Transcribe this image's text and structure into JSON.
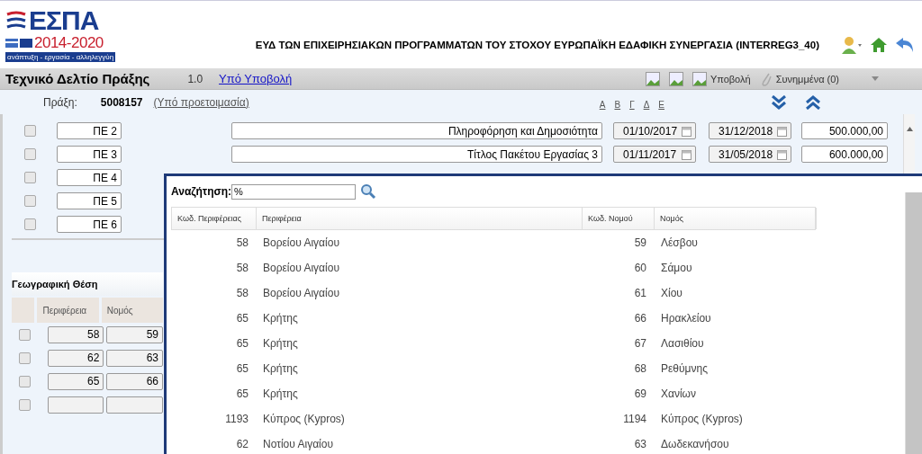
{
  "logo": {
    "name": "ΕΣΠΑ",
    "years": "2014-2020",
    "motto": "ανάπτυξη - εργασία - αλληλεγγύη"
  },
  "header": {
    "title": "ΕΥΔ ΤΩΝ ΕΠΙΧΕΙΡΗΣΙΑΚΩΝ ΠΡΟΓΡΑΜΜΑΤΩΝ ΤΟΥ ΣΤΟΧΟΥ ΕΥΡΩΠΑΪΚΗ ΕΔΑΦΙΚΗ ΣΥΝΕΡΓΑΣΙΑ (INTERREG3_40)"
  },
  "title_bar": {
    "title": "Τεχνικό Δελτίο Πράξης",
    "version": "1.0",
    "status_link": "Υπό Υποβολή",
    "submit": "Υποβολή",
    "attachments": "Συνημμένα (0)"
  },
  "sub_bar": {
    "label": "Πράξη:",
    "code": "5008157",
    "status": "(Υπό προετοιμασία)",
    "sections": [
      "Α",
      "Β",
      "Γ",
      "Δ",
      "Ε"
    ]
  },
  "work_packages": [
    {
      "code": "ΠΕ 2",
      "title": "Πληροφόρηση και Δημοσιότητα",
      "start": "01/10/2017",
      "end": "31/12/2018",
      "amount": "500.000,00",
      "checked": false
    },
    {
      "code": "ΠΕ 3",
      "title": "Τίτλος Πακέτου Εργασίας 3",
      "start": "01/11/2017",
      "end": "31/05/2018",
      "amount": "600.000,00",
      "checked": false
    },
    {
      "code": "ΠΕ 4",
      "checked": false
    },
    {
      "code": "ΠΕ 5",
      "checked": false
    },
    {
      "code": "ΠΕ 6",
      "checked": false
    }
  ],
  "geo": {
    "title": "Γεωγραφική Θέση",
    "columns": [
      "Περιφέρεια",
      "Νομός"
    ],
    "rows": [
      {
        "region": "58",
        "prefecture": "59",
        "checked": false
      },
      {
        "region": "62",
        "prefecture": "63",
        "checked": false
      },
      {
        "region": "65",
        "prefecture": "66",
        "checked": false
      },
      {
        "region": "",
        "prefecture": "",
        "checked": false
      }
    ]
  },
  "dialog": {
    "search_label": "Αναζήτηση:",
    "search_value": "%",
    "columns": [
      "Κωδ. Περιφέρειας",
      "Περιφέρεια",
      "Κωδ. Νομού",
      "Νομός"
    ],
    "rows": [
      [
        "58",
        "Βορείου Αιγαίου",
        "59",
        "Λέσβου"
      ],
      [
        "58",
        "Βορείου Αιγαίου",
        "60",
        "Σάμου"
      ],
      [
        "58",
        "Βορείου Αιγαίου",
        "61",
        "Χίου"
      ],
      [
        "65",
        "Κρήτης",
        "66",
        "Ηρακλείου"
      ],
      [
        "65",
        "Κρήτης",
        "67",
        "Λασιθίου"
      ],
      [
        "65",
        "Κρήτης",
        "68",
        "Ρεθύμνης"
      ],
      [
        "65",
        "Κρήτης",
        "69",
        "Χανίων"
      ],
      [
        "1193",
        "Κύπρος (Kypros)",
        "1194",
        "Κύπρος (Kypros)"
      ],
      [
        "62",
        "Νοτίου Αιγαίου",
        "63",
        "Δωδεκανήσου"
      ]
    ]
  }
}
